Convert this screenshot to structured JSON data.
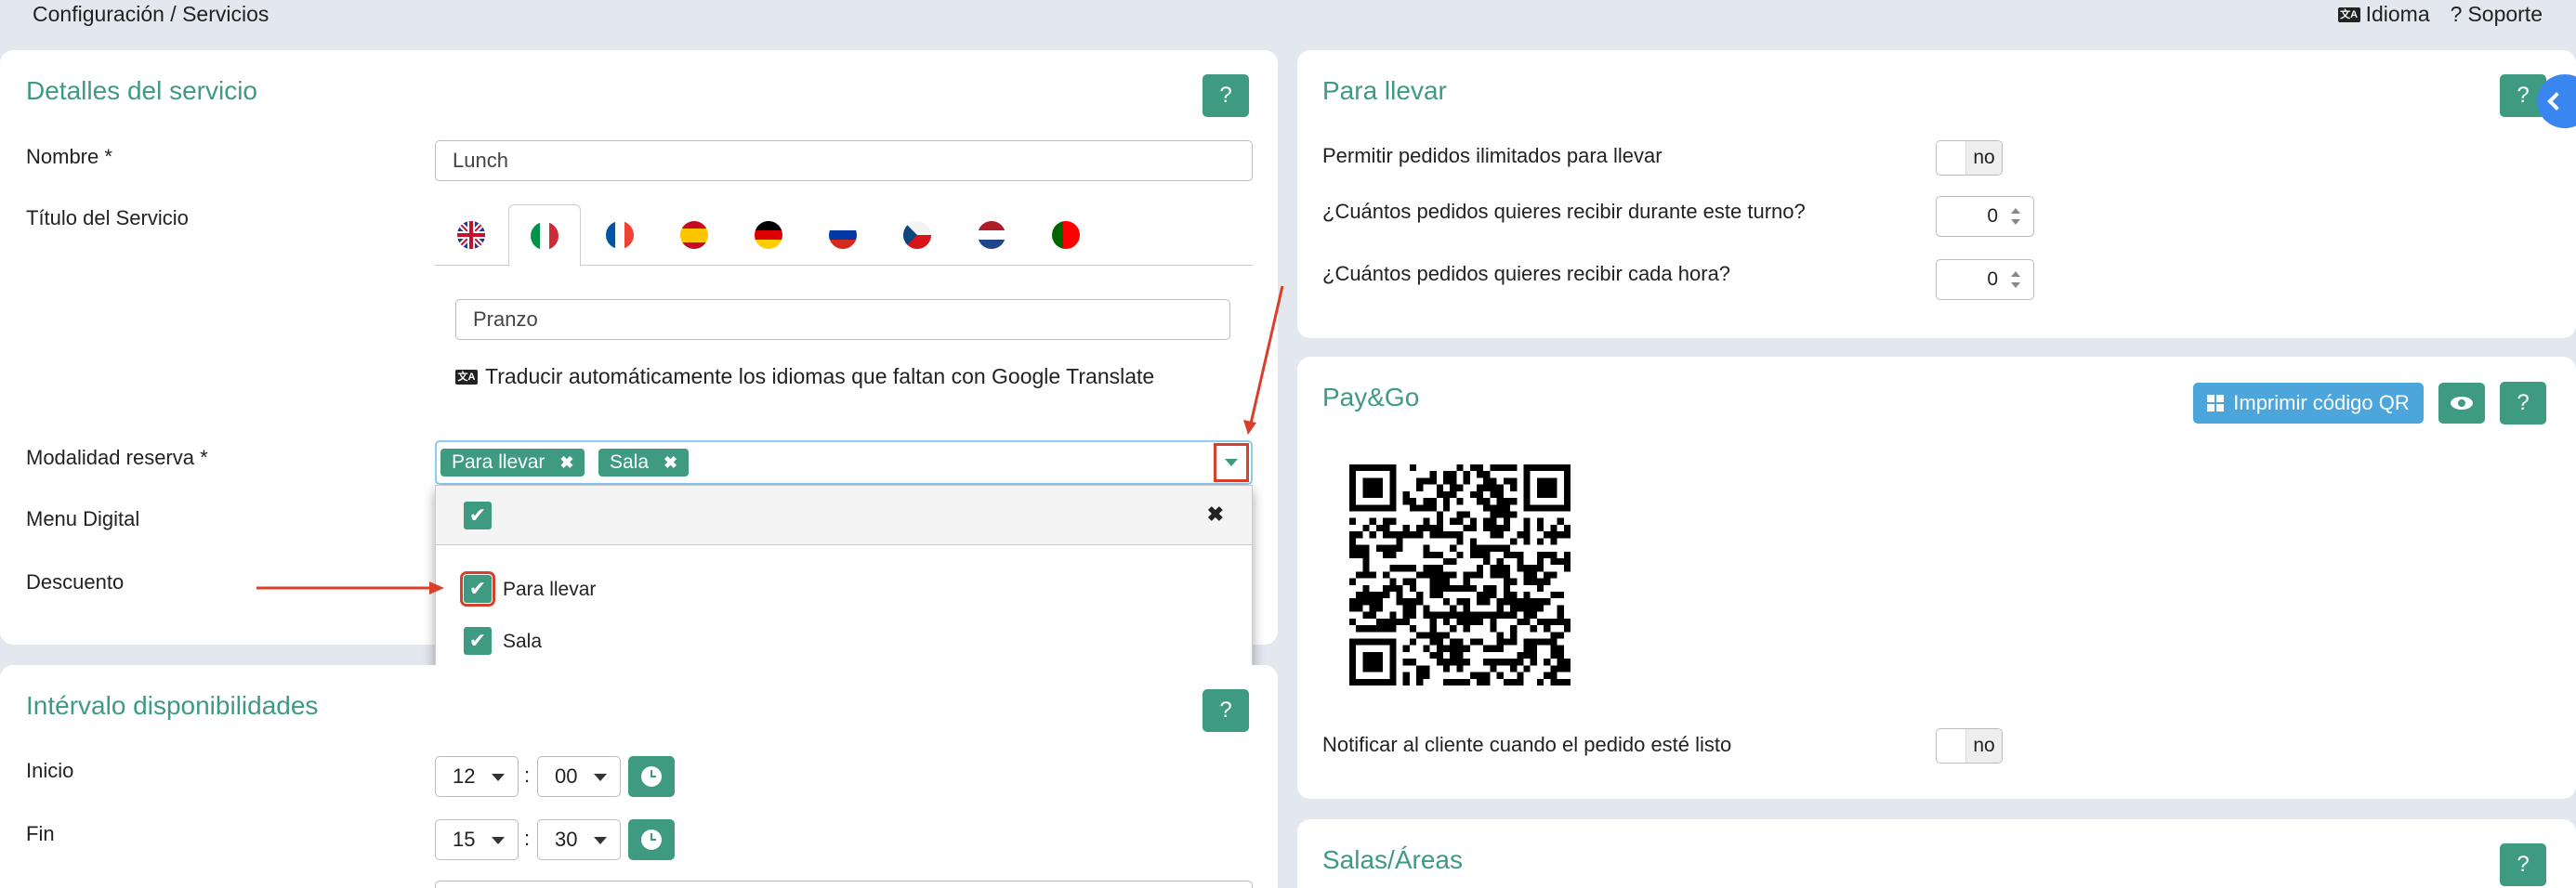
{
  "header": {
    "breadcrumb": "Configuración / Servicios",
    "idioma": "Idioma",
    "soporte": "Soporte",
    "help_glyph": "?"
  },
  "servicio": {
    "title": "Detalles del servicio",
    "help": "?",
    "nombre_label": "Nombre *",
    "nombre_value": "Lunch",
    "titulo_label": "Título del Servicio",
    "languages": [
      {
        "code": "en",
        "icon": "uk-flag-icon"
      },
      {
        "code": "it",
        "icon": "italy-flag-icon",
        "active": true
      },
      {
        "code": "fr",
        "icon": "france-flag-icon"
      },
      {
        "code": "es",
        "icon": "spain-flag-icon"
      },
      {
        "code": "de",
        "icon": "germany-flag-icon"
      },
      {
        "code": "ru",
        "icon": "russia-flag-icon"
      },
      {
        "code": "cz",
        "icon": "czech-flag-icon"
      },
      {
        "code": "nl",
        "icon": "netherlands-flag-icon"
      },
      {
        "code": "pt",
        "icon": "portugal-flag-icon"
      }
    ],
    "titulo_value": "Pranzo",
    "translate_text": "Traducir automáticamente los idiomas que faltan con Google Translate",
    "modalidad_label": "Modalidad reserva *",
    "tags": [
      "Para llevar",
      "Sala"
    ],
    "tag_remove": "✖",
    "menu_label": "Menu Digital",
    "descuento_label": "Descuento",
    "dropdown": {
      "check_glyph": "✔",
      "close_glyph": "✖",
      "options": [
        {
          "label": "Para llevar",
          "checked": true
        },
        {
          "label": "Sala",
          "checked": true
        }
      ]
    }
  },
  "intervalo": {
    "title": "Intérvalo disponibilidades",
    "help": "?",
    "inicio_label": "Inicio",
    "inicio_h": "12",
    "inicio_m": "00",
    "fin_label": "Fin",
    "fin_h": "15",
    "fin_m": "30",
    "sep": ":"
  },
  "para_llevar": {
    "title": "Para llevar",
    "help": "?",
    "q1": "Permitir pedidos ilimitados para llevar",
    "q1_toggle": "no",
    "q2": "¿Cuántos pedidos quieres recibir durante este turno?",
    "q2_value": "0",
    "q3": "¿Cuántos pedidos quieres recibir cada hora?",
    "q3_value": "0"
  },
  "paygo": {
    "title": "Pay&Go",
    "print_qr": "Imprimir código QR",
    "help": "?",
    "notificar": "Notificar al cliente cuando el pedido esté listo",
    "notificar_toggle": "no"
  },
  "salas": {
    "title": "Salas/Áreas",
    "help": "?"
  },
  "colors": {
    "teal": "#3f9a82",
    "title_teal": "#3e9a84",
    "blue": "#4ca6dc",
    "annotation_red": "#d8402c"
  }
}
